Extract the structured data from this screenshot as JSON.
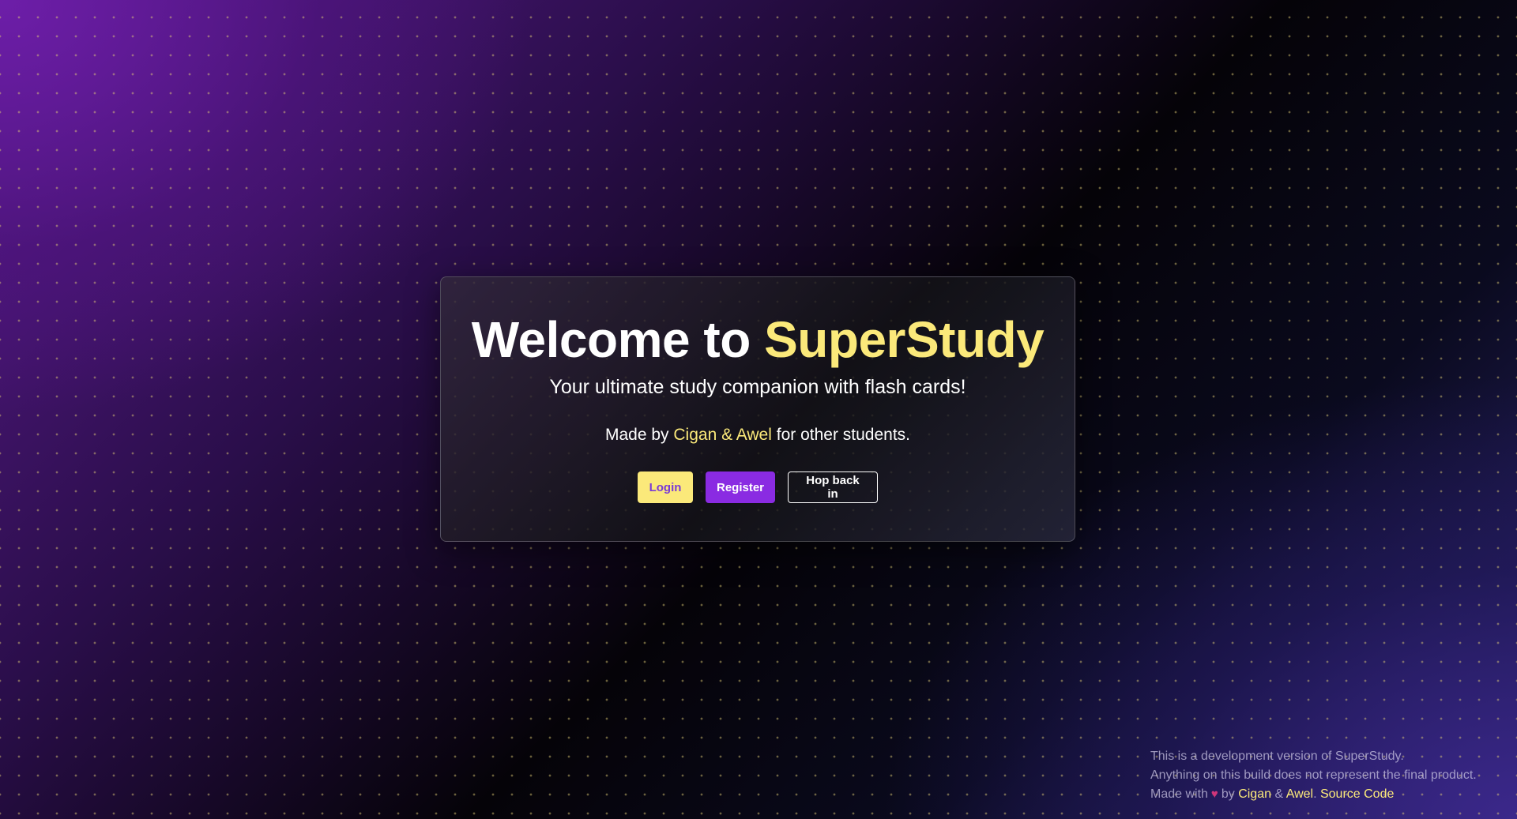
{
  "hero": {
    "title_prefix": "Welcome to ",
    "title_brand": "SuperStudy",
    "subtitle": "Your ultimate study companion with flash cards!",
    "credits_prefix": "Made by ",
    "credits_names": "Cigan & Awel",
    "credits_suffix": " for other students."
  },
  "buttons": {
    "login": "Login",
    "register": "Register",
    "hop_back": "Hop back in"
  },
  "footer": {
    "line1": "This is a development version of SuperStudy.",
    "line2": "Anything on this build does not represent the final product.",
    "made_with": "Made with",
    "by": "by",
    "author1": "Cigan",
    "amp": "&",
    "author2": "Awel",
    "period": ".",
    "source_code": "Source Code"
  },
  "colors": {
    "accent_yellow": "#fbe97a",
    "accent_purple": "#8a2be2",
    "heart": "#d0357a"
  },
  "icons": {
    "heart": "heart-icon"
  }
}
